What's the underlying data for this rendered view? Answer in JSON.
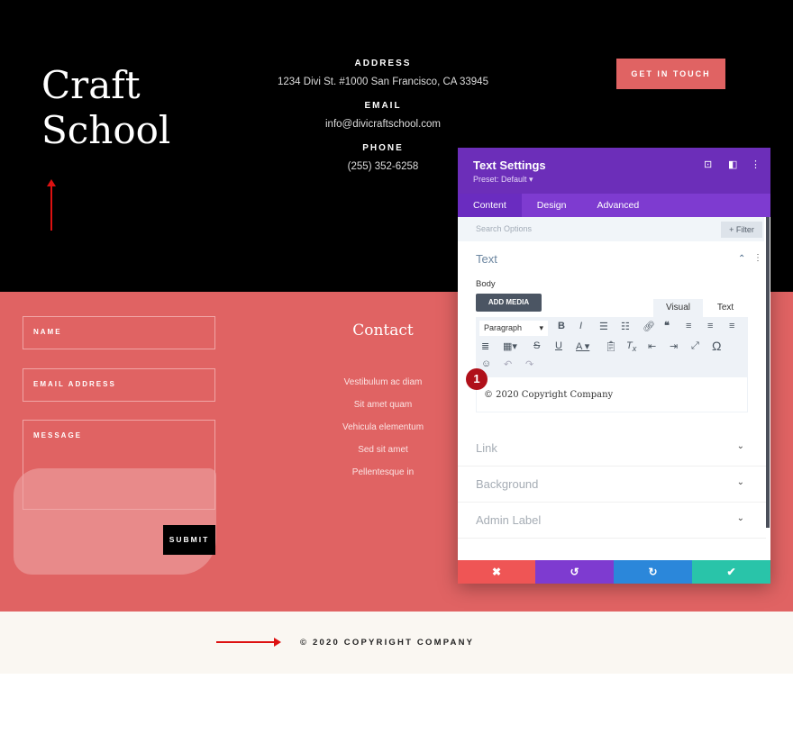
{
  "header": {
    "logo_line1": "Craft",
    "logo_line2": "School",
    "address_label": "ADDRESS",
    "address": "1234 Divi St. #1000 San Francisco, CA 33945",
    "email_label": "EMAIL",
    "email": "info@divicraftschool.com",
    "phone_label": "PHONE",
    "phone": "(255) 352-6258",
    "cta": "GET IN TOUCH"
  },
  "form": {
    "name": "NAME",
    "email": "EMAIL ADDRESS",
    "message": "MESSAGE",
    "submit": "SUBMIT"
  },
  "contact": {
    "title": "Contact",
    "links": [
      "Vestibulum ac diam",
      "Sit amet quam",
      "Vehicula elementum",
      "Sed sit amet",
      "Pellentesque in"
    ]
  },
  "footer": {
    "copyright": "© 2020 COPYRIGHT COMPANY"
  },
  "modal": {
    "title": "Text Settings",
    "preset": "Preset: Default ▾",
    "tabs": [
      "Content",
      "Design",
      "Advanced"
    ],
    "search_placeholder": "Search Options",
    "filter": "+ Filter",
    "section": "Text",
    "body_label": "Body",
    "add_media": "ADD MEDIA",
    "visual": "Visual",
    "text": "Text",
    "format": "Paragraph",
    "editor_content": "© 2020 Copyright Company",
    "badge": "1",
    "sections": [
      "Link",
      "Background",
      "Admin Label"
    ],
    "colors": {
      "header": "#6c2eb9",
      "cancel": "#ef5555",
      "undo": "#7e3bd0",
      "redo": "#2b87da",
      "save": "#29c4a9"
    }
  }
}
